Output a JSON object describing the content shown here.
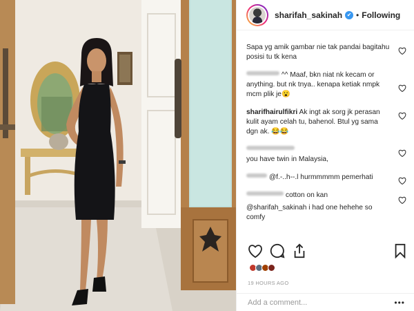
{
  "header": {
    "username": "sharifah_sakinah",
    "verified_glyph": "✔",
    "separator": "•",
    "follow_label": "Following"
  },
  "comments": [
    {
      "user": "",
      "text": "Sapa yg amik gambar nie tak pandai bagitahu posisi tu tk kena"
    },
    {
      "user": "",
      "text": "^^ Maaf, bkn niat nk kecam or anything. but nk tnya.. kenapa ketiak nmpk mcm plik je😮"
    },
    {
      "user": "sharifhairulfikri",
      "text": "Ak ingt ak sorg jk perasan kulit ayam celah tu, bahenol. Btul yg sama dgn ak. 😂😂"
    },
    {
      "user": "",
      "text": "you have twin in Malaysia,"
    },
    {
      "user": "",
      "text": "@f.-..h--.l   hurmmmmm pemerhati"
    },
    {
      "user": "",
      "text": "cotton on kan"
    },
    {
      "user": "",
      "text": "@sharifah_sakinah i had one hehehe so comfy"
    }
  ],
  "actions": {
    "like_icon": "heart-icon",
    "comment_icon": "comment-icon",
    "share_icon": "share-icon",
    "save_icon": "bookmark-icon"
  },
  "timestamp": "19 HOURS AGO",
  "add_comment": {
    "placeholder": "Add a comment...",
    "more_label": "•••"
  },
  "colors": {
    "accent_blue": "#3897f0",
    "text": "#262626",
    "muted": "#999999",
    "border": "#efefef"
  }
}
